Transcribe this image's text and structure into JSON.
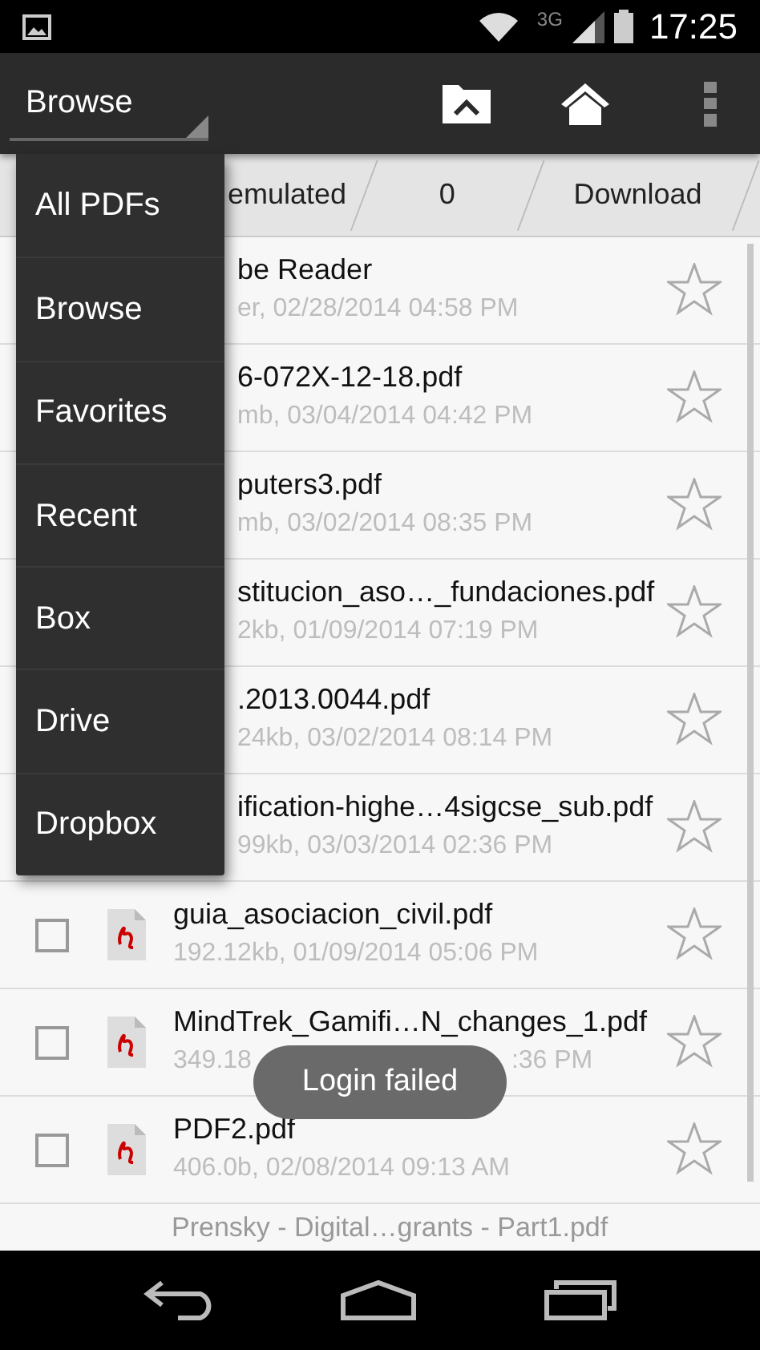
{
  "status_bar": {
    "network": "3G",
    "time": "17:25"
  },
  "action_bar": {
    "spinner": "Browse"
  },
  "breadcrumbs": [
    "emulated",
    "0",
    "Download"
  ],
  "files": [
    {
      "kind": "covered",
      "name": "be Reader",
      "meta": "er, 02/28/2014 04:58 PM",
      "starred": false
    },
    {
      "kind": "covered",
      "name": "6-072X-12-18.pdf",
      "meta": "mb, 03/04/2014 04:42 PM",
      "starred": false
    },
    {
      "kind": "covered",
      "name": "puters3.pdf",
      "meta": "mb, 03/02/2014 08:35 PM",
      "starred": false
    },
    {
      "kind": "covered",
      "name": "stitucion_aso…_fundaciones.pdf",
      "meta": "2kb, 01/09/2014 07:19 PM",
      "starred": false
    },
    {
      "kind": "covered",
      "name": ".2013.0044.pdf",
      "meta": "24kb, 03/02/2014 08:14 PM",
      "starred": false
    },
    {
      "kind": "covered",
      "name": "ification-highe…4sigcse_sub.pdf",
      "meta": "99kb, 03/03/2014 02:36 PM",
      "starred": false
    },
    {
      "kind": "full",
      "checked": false,
      "name": "guia_asociacion_civil.pdf",
      "meta": "192.12kb, 01/09/2014 05:06 PM",
      "starred": false
    },
    {
      "kind": "full",
      "checked": false,
      "name": "MindTrek_Gamifi…N_changes_1.pdf",
      "meta": "349.18",
      "meta_tail": ":36 PM",
      "starred": false
    },
    {
      "kind": "full",
      "checked": false,
      "name": "PDF2.pdf",
      "meta": "406.0b, 02/08/2014 09:13 AM",
      "starred": false
    },
    {
      "kind": "partial",
      "name": "Prensky - Digital…grants - Part1.pdf"
    }
  ],
  "menu": [
    "All PDFs",
    "Browse",
    "Favorites",
    "Recent",
    "Box",
    "Drive",
    "Dropbox"
  ],
  "toast": "Login failed"
}
